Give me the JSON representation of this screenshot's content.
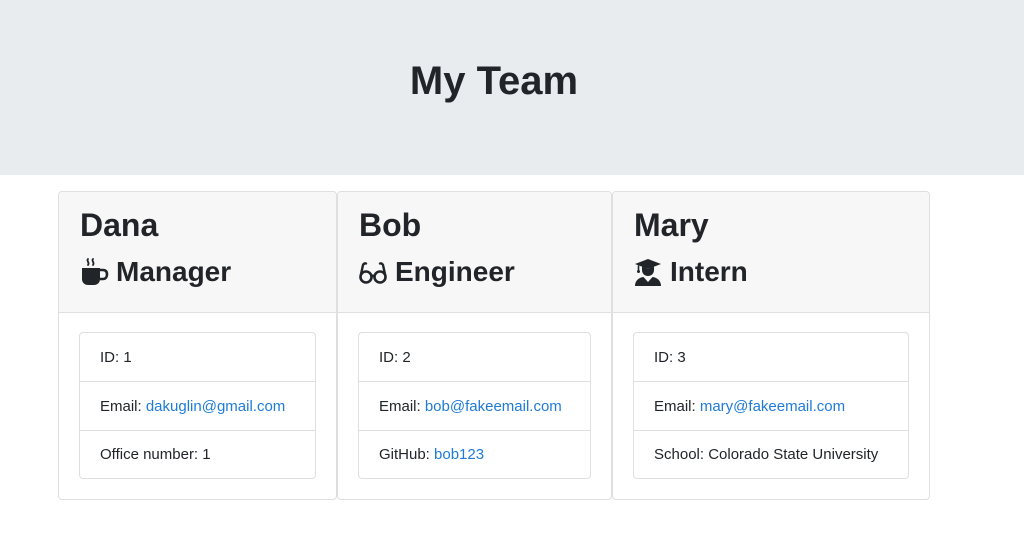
{
  "header": {
    "title": "My Team"
  },
  "team": [
    {
      "name": "Dana",
      "role": "Manager",
      "icon": "coffee-icon",
      "id_label": "ID: ",
      "id": "1",
      "email_label": "Email: ",
      "email": "dakuglin@gmail.com",
      "extra_label": "Office number: ",
      "extra_value": "1"
    },
    {
      "name": "Bob",
      "role": "Engineer",
      "icon": "glasses-icon",
      "id_label": "ID: ",
      "id": "2",
      "email_label": "Email: ",
      "email": "bob@fakeemail.com",
      "extra_label": "GitHub: ",
      "extra_value": "bob123"
    },
    {
      "name": "Mary",
      "role": "Intern",
      "icon": "graduate-icon",
      "id_label": "ID: ",
      "id": "3",
      "email_label": "Email: ",
      "email": "mary@fakeemail.com",
      "extra_label": "School: ",
      "extra_value": "Colorado State University"
    }
  ],
  "colors": {
    "link": "#1e7bd8",
    "jumbotron": "#e9ecef",
    "card_header": "#f7f7f7"
  }
}
